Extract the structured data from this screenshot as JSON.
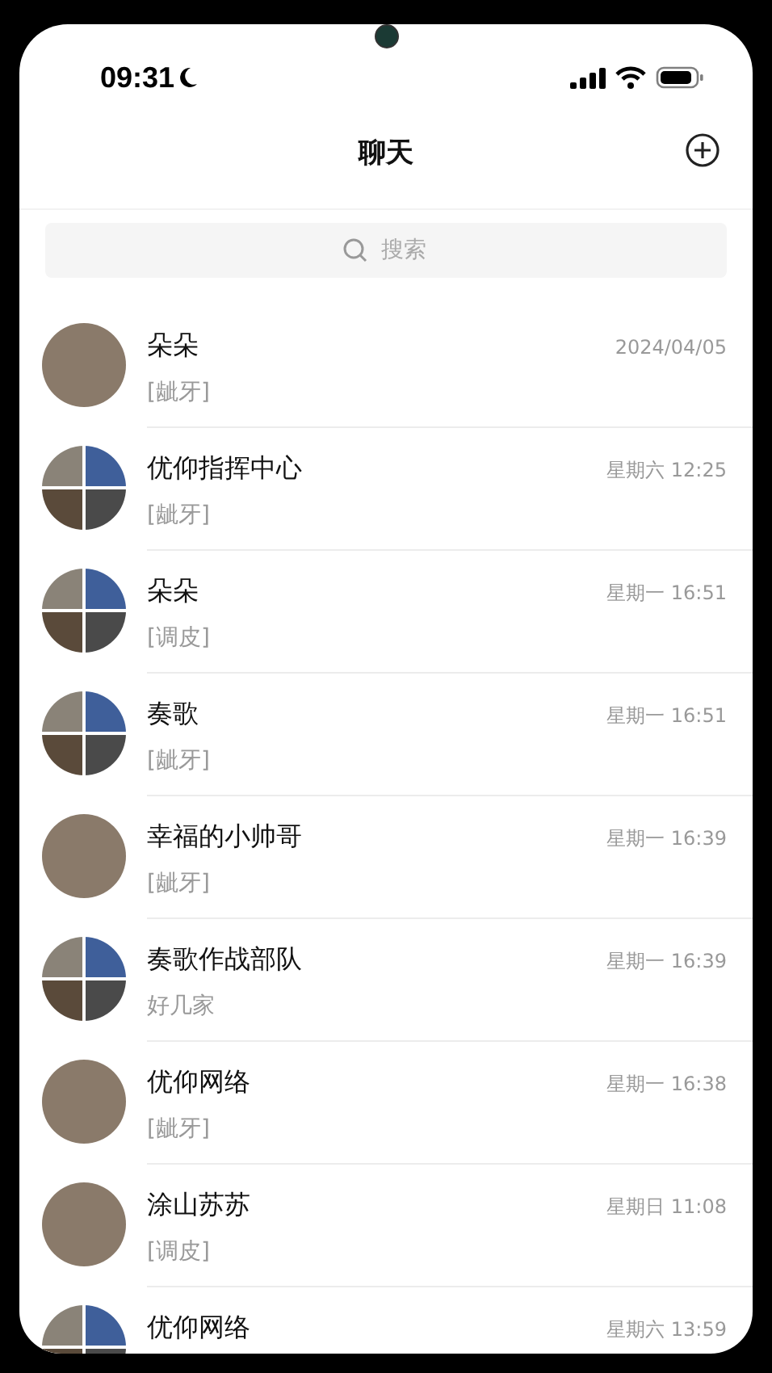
{
  "status_bar": {
    "time": "09:31"
  },
  "header": {
    "title": "聊天"
  },
  "search": {
    "placeholder": "搜索"
  },
  "chats": [
    {
      "name": "朵朵",
      "time": "2024/04/05",
      "preview": "[龇牙]",
      "kind": "single"
    },
    {
      "name": "优仰指挥中心",
      "time": "星期六 12:25",
      "preview": "[龇牙]",
      "kind": "group"
    },
    {
      "name": "朵朵",
      "time": "星期一 16:51",
      "preview": "[调皮]",
      "kind": "group"
    },
    {
      "name": "奏歌",
      "time": "星期一 16:51",
      "preview": "[龇牙]",
      "kind": "group"
    },
    {
      "name": "幸福的小帅哥",
      "time": "星期一 16:39",
      "preview": "[龇牙]",
      "kind": "single"
    },
    {
      "name": "奏歌作战部队",
      "time": "星期一 16:39",
      "preview": "好几家",
      "kind": "group"
    },
    {
      "name": "优仰网络",
      "time": "星期一 16:38",
      "preview": "[龇牙]",
      "kind": "single"
    },
    {
      "name": "涂山苏苏",
      "time": "星期日 11:08",
      "preview": "[调皮]",
      "kind": "single"
    },
    {
      "name": "优仰网络",
      "time": "星期六 13:59",
      "kind": "group"
    }
  ]
}
